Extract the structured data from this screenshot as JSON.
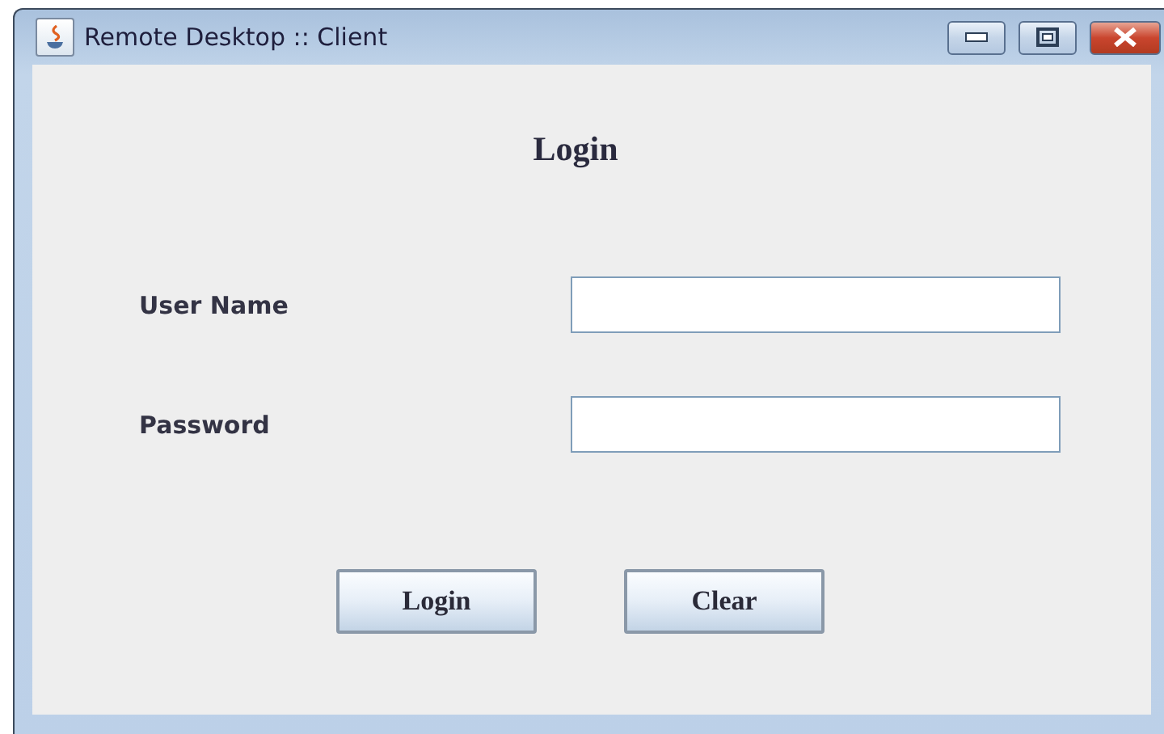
{
  "window": {
    "title": "Remote Desktop :: Client"
  },
  "heading": "Login",
  "fields": [
    {
      "label": "User Name"
    },
    {
      "label": "Password"
    }
  ],
  "buttons": [
    "Login",
    "Clear"
  ]
}
